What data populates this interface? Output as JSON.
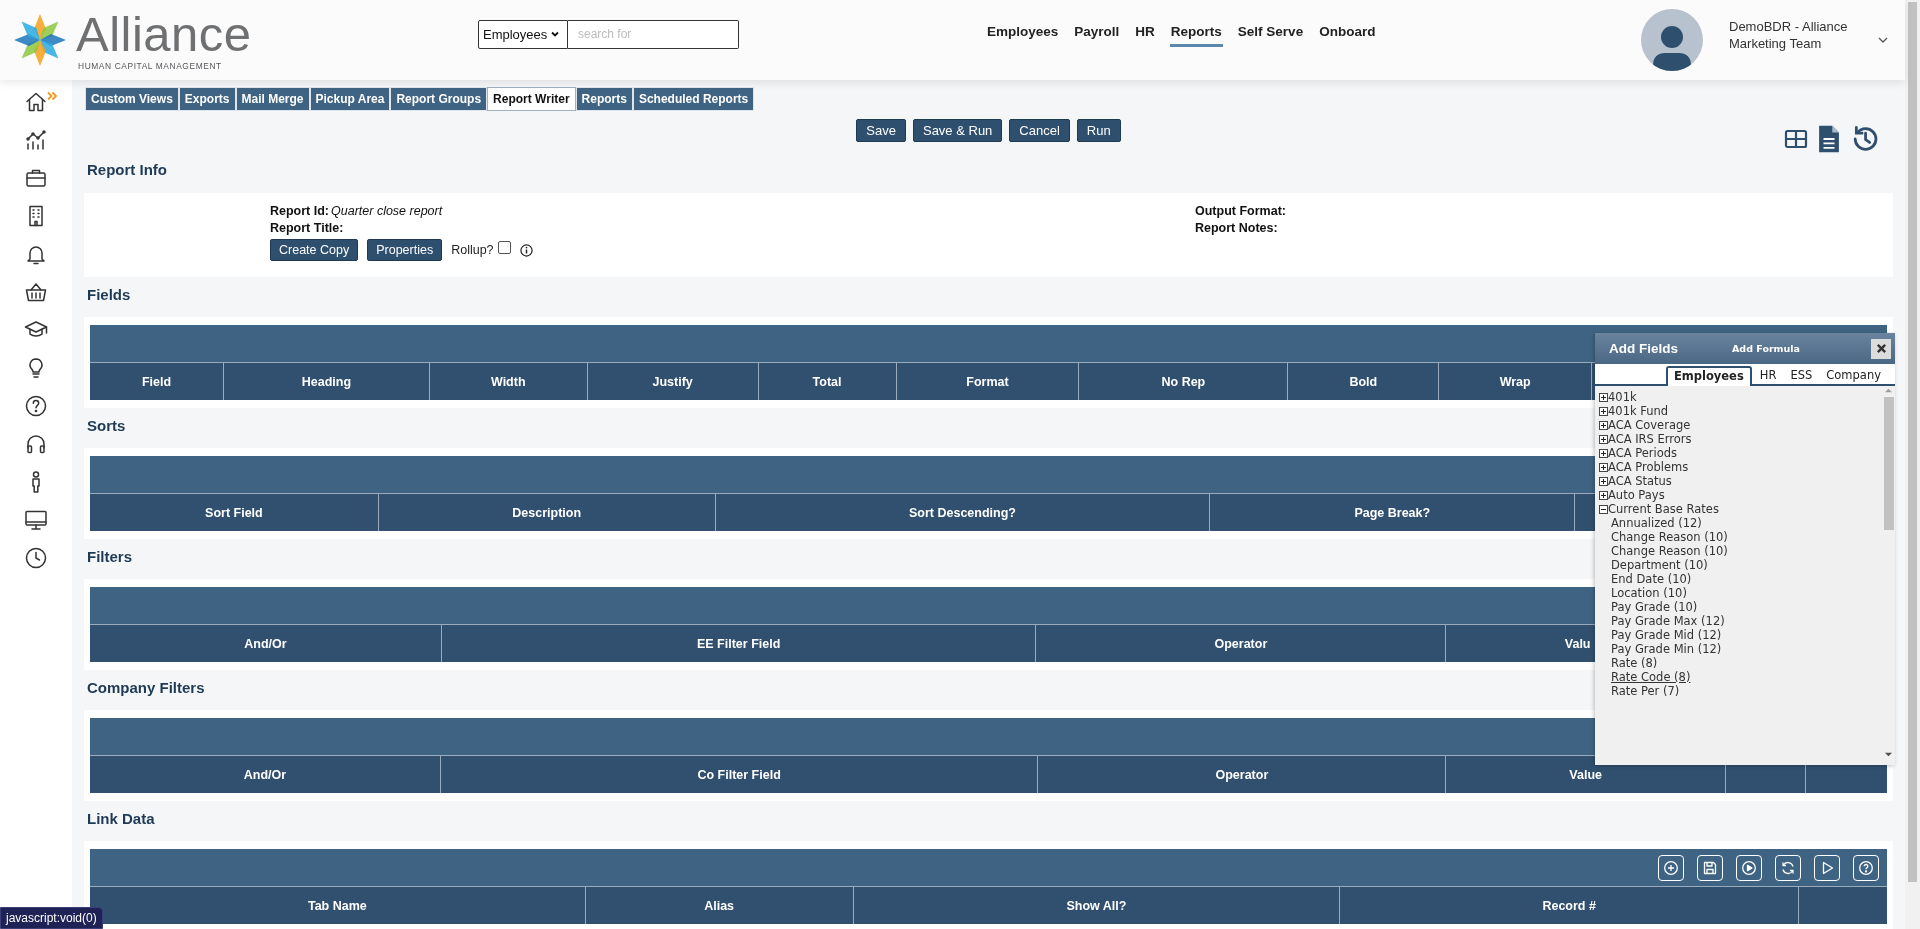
{
  "header": {
    "logo": {
      "name": "Alliance",
      "tagline": "HUMAN CAPITAL MANAGEMENT"
    },
    "search": {
      "scope": "Employees",
      "placeholder": "search for"
    },
    "nav": [
      {
        "label": "Employees",
        "selected": false
      },
      {
        "label": "Payroll",
        "selected": false
      },
      {
        "label": "HR",
        "selected": false
      },
      {
        "label": "Reports",
        "selected": true
      },
      {
        "label": "Self Serve",
        "selected": false
      },
      {
        "label": "Onboard",
        "selected": false
      }
    ],
    "user": {
      "name": "DemoBDR - Alliance Marketing Team"
    }
  },
  "tabs": [
    {
      "label": "Custom Views",
      "selected": false
    },
    {
      "label": "Exports",
      "selected": false
    },
    {
      "label": "Mail Merge",
      "selected": false
    },
    {
      "label": "Pickup Area",
      "selected": false
    },
    {
      "label": "Report Groups",
      "selected": false
    },
    {
      "label": "Report Writer",
      "selected": true
    },
    {
      "label": "Reports",
      "selected": false
    },
    {
      "label": "Scheduled Reports",
      "selected": false
    }
  ],
  "actions": [
    "Save",
    "Save & Run",
    "Cancel",
    "Run"
  ],
  "report_info": {
    "title": "Report Info",
    "left_fields": [
      {
        "label": "Report Id:",
        "value": "Quarter close report"
      },
      {
        "label": "Report Title:"
      }
    ],
    "right_fields": [
      {
        "label": "Output Format:"
      },
      {
        "label": "Report Notes:"
      }
    ],
    "buttons": [
      "Create Copy",
      "Properties"
    ],
    "rollup": {
      "label": "Rollup?",
      "checked": false
    }
  },
  "sections": [
    {
      "title": "Fields",
      "columns": [
        {
          "label": "Field"
        },
        {
          "label": "Heading"
        },
        {
          "label": "Width"
        },
        {
          "label": "Justify"
        },
        {
          "label": "Total"
        },
        {
          "label": "Format"
        },
        {
          "label": "No Rep"
        },
        {
          "label": "Bold"
        },
        {
          "label": "Wrap"
        }
      ]
    },
    {
      "title": "Sorts",
      "columns": [
        {
          "label": "Sort Field"
        },
        {
          "label": "Description"
        },
        {
          "label": "Sort Descending?"
        },
        {
          "label": "Page Break?"
        }
      ]
    },
    {
      "title": "Filters",
      "columns": [
        {
          "label": "And/Or"
        },
        {
          "label": "EE Filter Field"
        },
        {
          "label": "Operator"
        },
        {
          "label": "Valu"
        }
      ]
    },
    {
      "title": "Company Filters",
      "columns": [
        {
          "label": "And/Or"
        },
        {
          "label": "Co Filter Field"
        },
        {
          "label": "Operator"
        },
        {
          "label": "Value"
        }
      ]
    },
    {
      "title": "Link Data",
      "columns": [
        {
          "label": "Tab Name"
        },
        {
          "label": "Alias"
        },
        {
          "label": "Show All?"
        },
        {
          "label": "Record #"
        }
      ]
    }
  ],
  "add_fields": {
    "title": "Add Fields",
    "link": "Add Formula",
    "tabs": [
      {
        "label": "Employees",
        "selected": true
      },
      {
        "label": "HR",
        "selected": false
      },
      {
        "label": "ESS",
        "selected": false
      },
      {
        "label": "Company",
        "selected": false
      }
    ],
    "tree": [
      {
        "label": "401k",
        "expanded": false
      },
      {
        "label": "401k Fund",
        "expanded": false
      },
      {
        "label": "ACA Coverage",
        "expanded": false
      },
      {
        "label": "ACA IRS Errors",
        "expanded": false
      },
      {
        "label": "ACA Periods",
        "expanded": false
      },
      {
        "label": "ACA Problems",
        "expanded": false
      },
      {
        "label": "ACA Status",
        "expanded": false
      },
      {
        "label": "Auto Pays",
        "expanded": false
      },
      {
        "label": "Current Base Rates",
        "expanded": true,
        "children": [
          {
            "label": "Annualized (12)",
            "hovered": false
          },
          {
            "label": "Change Reason (10)",
            "hovered": false
          },
          {
            "label": "Change Reason (10)",
            "hovered": false
          },
          {
            "label": "Department (10)",
            "hovered": false
          },
          {
            "label": "End Date (10)",
            "hovered": false
          },
          {
            "label": "Location (10)",
            "hovered": false
          },
          {
            "label": "Pay Grade (10)",
            "hovered": false
          },
          {
            "label": "Pay Grade Max (12)",
            "hovered": false
          },
          {
            "label": "Pay Grade Mid (12)",
            "hovered": false
          },
          {
            "label": "Pay Grade Min (12)",
            "hovered": false
          },
          {
            "label": "Rate (8)",
            "hovered": false
          },
          {
            "label": "Rate Code (8)",
            "hovered": true
          },
          {
            "label": "Rate Per (7)",
            "hovered": false
          }
        ]
      }
    ]
  },
  "status_bar": {
    "text": "javascript:void(0)"
  }
}
